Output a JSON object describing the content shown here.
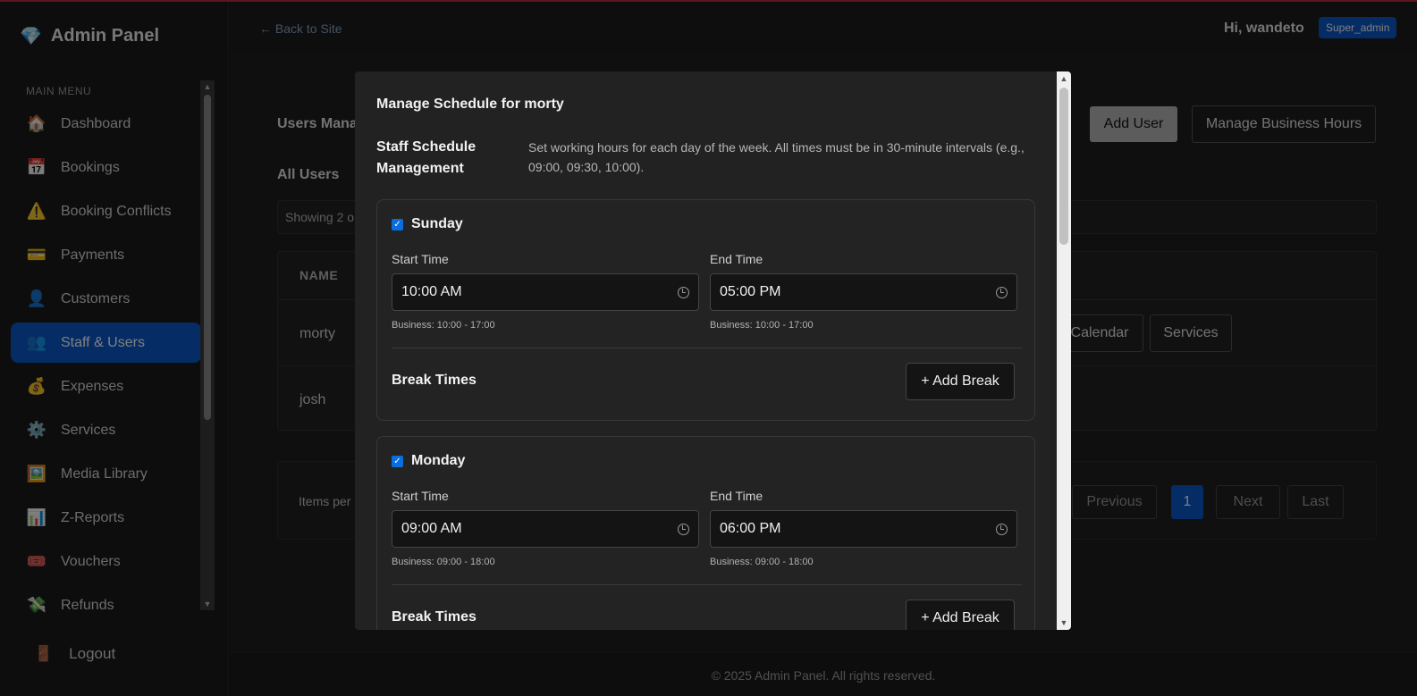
{
  "sidebar": {
    "brand": "Admin Panel",
    "brand_icon": "gem-icon",
    "menu_heading": "MAIN MENU",
    "items": [
      {
        "label": "Dashboard",
        "icon": "🏠"
      },
      {
        "label": "Bookings",
        "icon": "📅"
      },
      {
        "label": "Booking Conflicts",
        "icon": "⚠️"
      },
      {
        "label": "Payments",
        "icon": "💳"
      },
      {
        "label": "Customers",
        "icon": "👤"
      },
      {
        "label": "Staff & Users",
        "icon": "👥",
        "active": true
      },
      {
        "label": "Expenses",
        "icon": "💰"
      },
      {
        "label": "Services",
        "icon": "⚙️"
      },
      {
        "label": "Media Library",
        "icon": "🖼️"
      },
      {
        "label": "Z-Reports",
        "icon": "📊"
      },
      {
        "label": "Vouchers",
        "icon": "🎟️"
      },
      {
        "label": "Refunds",
        "icon": "💸"
      }
    ],
    "logout": "Logout",
    "logout_icon": "🚪"
  },
  "topbar": {
    "back_link": "← Back to Site",
    "greeting": "Hi, wandeto",
    "role": "Super_admin"
  },
  "main": {
    "page_title": "Users Mana",
    "add_user": "Add User",
    "manage_business_hours": "Manage Business Hours",
    "section_title": "All Users",
    "showing": "Showing 2 o",
    "table": {
      "header_name": "NAME",
      "rows": [
        {
          "name": "morty",
          "calendar": "Calendar",
          "services": "Services"
        },
        {
          "name": "josh"
        }
      ]
    },
    "pagination": {
      "items_per": "Items per",
      "previous": "Previous",
      "page": "1",
      "next": "Next",
      "last": "Last"
    }
  },
  "footer": "© 2025 Admin Panel. All rights reserved.",
  "modal": {
    "title": "Manage Schedule for morty",
    "mgmt_title": "Staff Schedule Management",
    "mgmt_desc": "Set working hours for each day of the week. All times must be in 30-minute intervals (e.g., 09:00, 09:30, 10:00).",
    "days": [
      {
        "day": "Sunday",
        "checked": true,
        "start_label": "Start Time",
        "start": "10:00 AM",
        "end_label": "End Time",
        "end": "05:00 PM",
        "start_biz": "Business: 10:00 - 17:00",
        "end_biz": "Business: 10:00 - 17:00",
        "break_title": "Break Times",
        "add_break": "+ Add Break"
      },
      {
        "day": "Monday",
        "checked": true,
        "start_label": "Start Time",
        "start": "09:00 AM",
        "end_label": "End Time",
        "end": "06:00 PM",
        "start_biz": "Business: 09:00 - 18:00",
        "end_biz": "Business: 09:00 - 18:00",
        "break_title": "Break Times",
        "add_break": "+ Add Break"
      }
    ]
  },
  "colors": {
    "accent": "#0a58ca",
    "top_line": "#c0283c"
  }
}
